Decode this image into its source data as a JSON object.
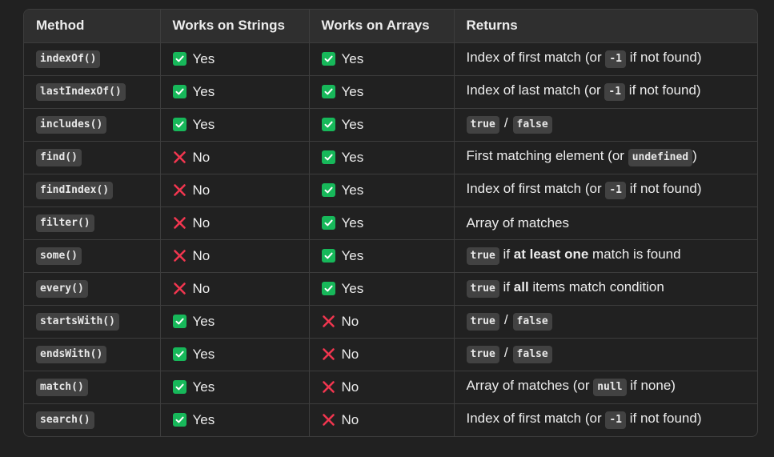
{
  "headers": [
    "Method",
    "Works on Strings",
    "Works on Arrays",
    "Returns"
  ],
  "values": {
    "yes": "Yes",
    "no": "No"
  },
  "rows": [
    {
      "method": "indexOf()",
      "strings": "yes",
      "arrays": "yes",
      "returns": [
        {
          "t": "text",
          "v": "Index of first match (or "
        },
        {
          "t": "code",
          "v": "-1"
        },
        {
          "t": "text",
          "v": " if not found)"
        }
      ]
    },
    {
      "method": "lastIndexOf()",
      "strings": "yes",
      "arrays": "yes",
      "returns": [
        {
          "t": "text",
          "v": "Index of last match (or "
        },
        {
          "t": "code",
          "v": "-1"
        },
        {
          "t": "text",
          "v": " if not found)"
        }
      ]
    },
    {
      "method": "includes()",
      "strings": "yes",
      "arrays": "yes",
      "returns": [
        {
          "t": "code",
          "v": "true"
        },
        {
          "t": "sep",
          "v": "/"
        },
        {
          "t": "code",
          "v": "false"
        }
      ]
    },
    {
      "method": "find()",
      "strings": "no",
      "arrays": "yes",
      "returns": [
        {
          "t": "text",
          "v": "First matching element (or "
        },
        {
          "t": "code",
          "v": "undefined"
        },
        {
          "t": "text",
          "v": ")"
        }
      ]
    },
    {
      "method": "findIndex()",
      "strings": "no",
      "arrays": "yes",
      "returns": [
        {
          "t": "text",
          "v": "Index of first match (or "
        },
        {
          "t": "code",
          "v": "-1"
        },
        {
          "t": "text",
          "v": " if not found)"
        }
      ]
    },
    {
      "method": "filter()",
      "strings": "no",
      "arrays": "yes",
      "returns": [
        {
          "t": "text",
          "v": "Array of matches"
        }
      ]
    },
    {
      "method": "some()",
      "strings": "no",
      "arrays": "yes",
      "returns": [
        {
          "t": "code",
          "v": "true"
        },
        {
          "t": "text",
          "v": " if "
        },
        {
          "t": "bold",
          "v": "at least one"
        },
        {
          "t": "text",
          "v": " match is found"
        }
      ]
    },
    {
      "method": "every()",
      "strings": "no",
      "arrays": "yes",
      "returns": [
        {
          "t": "code",
          "v": "true"
        },
        {
          "t": "text",
          "v": " if "
        },
        {
          "t": "bold",
          "v": "all"
        },
        {
          "t": "text",
          "v": " items match condition"
        }
      ]
    },
    {
      "method": "startsWith()",
      "strings": "yes",
      "arrays": "no",
      "returns": [
        {
          "t": "code",
          "v": "true"
        },
        {
          "t": "sep",
          "v": "/"
        },
        {
          "t": "code",
          "v": "false"
        }
      ]
    },
    {
      "method": "endsWith()",
      "strings": "yes",
      "arrays": "no",
      "returns": [
        {
          "t": "code",
          "v": "true"
        },
        {
          "t": "sep",
          "v": "/"
        },
        {
          "t": "code",
          "v": "false"
        }
      ]
    },
    {
      "method": "match()",
      "strings": "yes",
      "arrays": "no",
      "returns": [
        {
          "t": "text",
          "v": "Array of matches (or "
        },
        {
          "t": "code",
          "v": "null"
        },
        {
          "t": "text",
          "v": " if none)"
        }
      ]
    },
    {
      "method": "search()",
      "strings": "yes",
      "arrays": "no",
      "returns": [
        {
          "t": "text",
          "v": "Index of first match (or "
        },
        {
          "t": "code",
          "v": "-1"
        },
        {
          "t": "text",
          "v": " if not found)"
        }
      ]
    }
  ],
  "colors": {
    "yes_icon": "#17b85a",
    "no_icon": "#f0364f",
    "background": "#212121",
    "header_bg": "#2f2f2f",
    "border": "#3d3d3d"
  },
  "icons": {
    "yes": "check-box-icon",
    "no": "cross-icon"
  }
}
